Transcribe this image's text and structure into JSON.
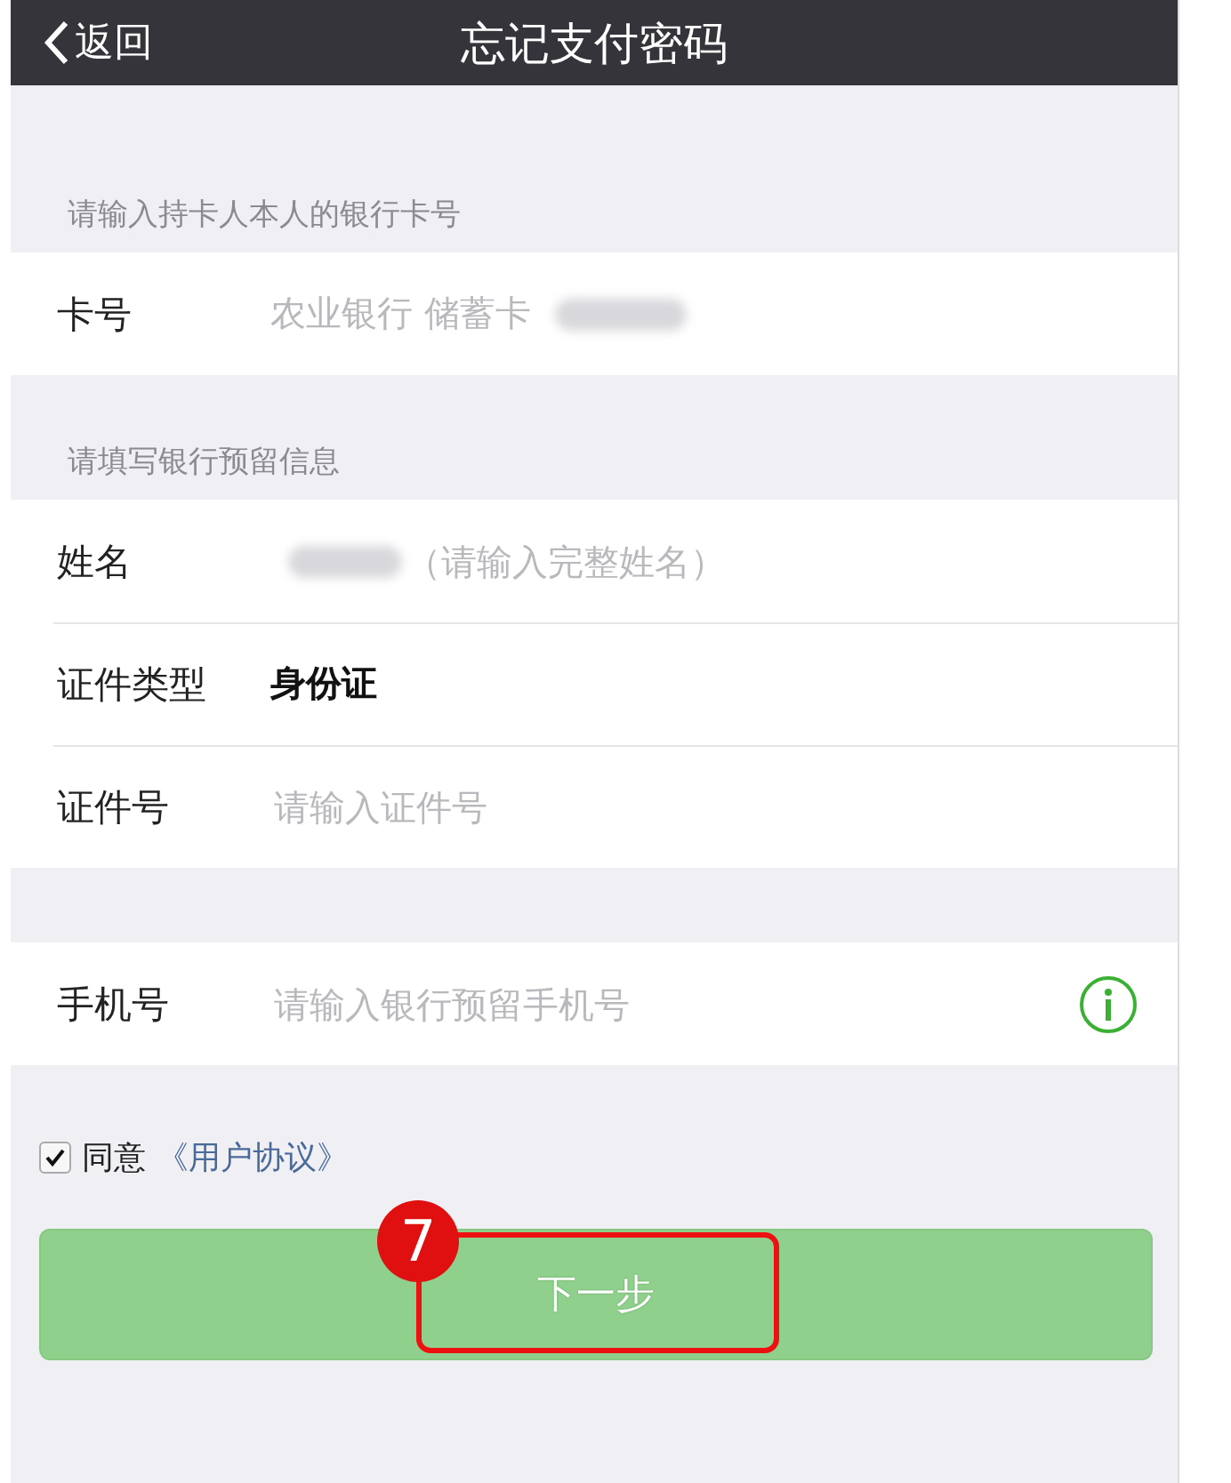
{
  "nav_bar": {
    "back_label": "返回",
    "title": "忘记支付密码"
  },
  "sections": [
    {
      "label": "请输入持卡人本人的银行卡号",
      "rows": [
        {
          "kind": "static",
          "label": "卡号",
          "value": "农业银行 储蓄卡",
          "redacted_after": true
        }
      ]
    },
    {
      "label": "请填写银行预留信息",
      "rows": [
        {
          "kind": "input",
          "label": "姓名",
          "placeholder": "（请输入完整姓名）",
          "redacted_before": true
        },
        {
          "kind": "static",
          "label": "证件类型",
          "value": "身份证",
          "emphasis": true
        },
        {
          "kind": "input",
          "label": "证件号",
          "placeholder": "请输入证件号"
        }
      ]
    },
    {
      "rows": [
        {
          "kind": "input",
          "label": "手机号",
          "placeholder": "请输入银行预留手机号",
          "info": true
        }
      ]
    }
  ],
  "agreement": {
    "checked": true,
    "label": "同意",
    "link": "《用户协议》"
  },
  "next_button": {
    "label": "下一步",
    "disabled": true
  },
  "annotation": {
    "step": "7"
  }
}
